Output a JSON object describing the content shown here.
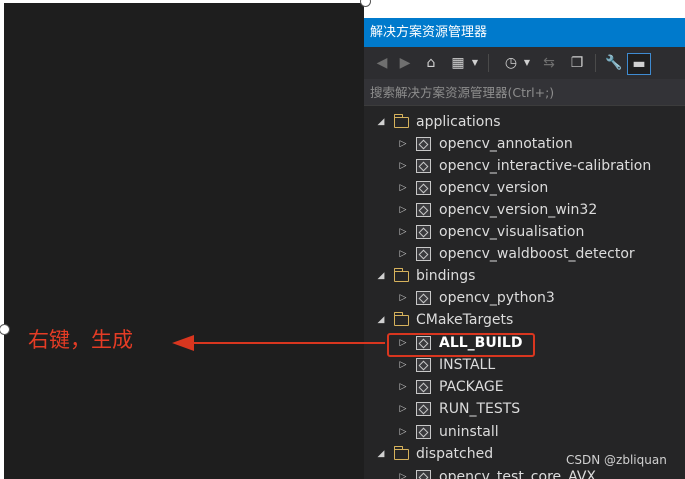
{
  "panel": {
    "title": "解决方案资源管理器",
    "search_placeholder": "搜索解决方案资源管理器(Ctrl+;)"
  },
  "toolbar": {
    "icons": [
      "back-icon",
      "forward-icon",
      "home-icon",
      "switch-views-icon",
      "dropdown-icon",
      "pending-changes-icon",
      "dropdown-icon",
      "sync-icon",
      "collapse-all-icon",
      "properties-icon",
      "preview-icon"
    ]
  },
  "tree": {
    "applications": {
      "label": "applications",
      "children": [
        "opencv_annotation",
        "opencv_interactive-calibration",
        "opencv_version",
        "opencv_version_win32",
        "opencv_visualisation",
        "opencv_waldboost_detector"
      ]
    },
    "bindings": {
      "label": "bindings",
      "children": [
        "opencv_python3"
      ]
    },
    "cmake_targets": {
      "label": "CMakeTargets",
      "children": [
        "ALL_BUILD",
        "INSTALL",
        "PACKAGE",
        "RUN_TESTS",
        "uninstall"
      ]
    },
    "dispatched": {
      "label": "dispatched",
      "children": [
        "opencv_test_core_AVX"
      ]
    }
  },
  "annotation": {
    "text": "右键，生成",
    "color": "#e53c25"
  },
  "watermark": "CSDN @zbliquan",
  "colors": {
    "title_bar": "#007acc",
    "panel_bg": "#252526",
    "highlight_border": "#d9361f"
  }
}
